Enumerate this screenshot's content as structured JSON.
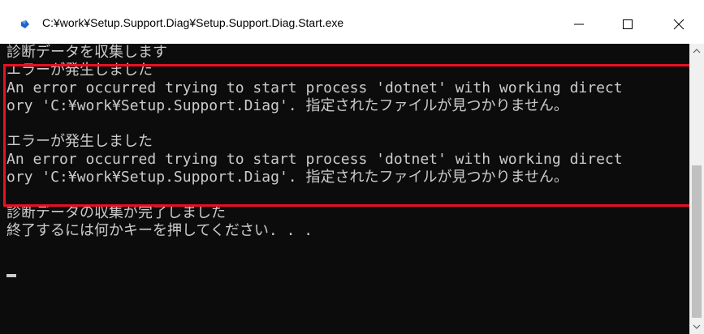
{
  "window": {
    "title": "C:¥work¥Setup.Support.Diag¥Setup.Support.Diag.Start.exe",
    "icon": "console-app-icon",
    "accent": "#1e64c8"
  },
  "controls": {
    "minimize": "minimize-icon",
    "maximize": "maximize-icon",
    "close": "close-icon"
  },
  "console": {
    "background": "#0c0c0c",
    "foreground": "#cccccc",
    "highlight_color": "#e81123",
    "lines": [
      "診断データを収集します",
      "エラーが発生しました",
      "An error occurred trying to start process 'dotnet' with working direct",
      "ory 'C:¥work¥Setup.Support.Diag'. 指定されたファイルが見つかりません。",
      "",
      "エラーが発生しました",
      "An error occurred trying to start process 'dotnet' with working direct",
      "ory 'C:¥work¥Setup.Support.Diag'. 指定されたファイルが見つかりません。",
      "",
      "診断データの収集が完了しました",
      "終了するには何かキーを押してください. . ."
    ]
  }
}
